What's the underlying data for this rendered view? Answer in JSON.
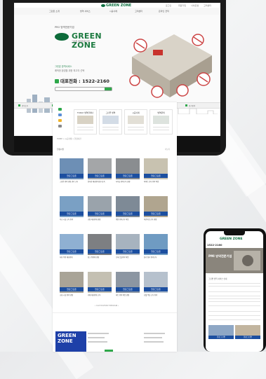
{
  "desktop": {
    "topbar_links": [
      "로그인",
      "회원가입",
      "사이트맵",
      "고객센터"
    ],
    "logo": "GREEN ZONE",
    "nav": [
      "그린존 소개",
      "방역 서비스",
      "시공사례",
      "고객센터",
      "온라인 견적"
    ],
    "hero": {
      "kicker": "PRO 방역전문기업",
      "brand": "GREEN ZONE",
      "brand_sub": "그린존 방역전문기업",
      "line1": "그린존 방역서비스",
      "line2": "쾌적한 환경을 위한 최고의 선택",
      "phone_label": "대표전화 :",
      "phone": "1522-2160",
      "search_label": "견적문의"
    },
    "infobar": [
      "방역소독",
      "해충방제",
      "쥐방제",
      "흰개미방제",
      "소독필증 발급",
      "정기방역"
    ]
  },
  "longpage": {
    "services": [
      {
        "title": "TODAY 방역플래너"
      },
      {
        "title": "그린존 방역"
      },
      {
        "title": "시공사례"
      },
      {
        "title": "방역문의"
      }
    ],
    "path": "HOME > 시공사례 > 현장사진",
    "section_title": "현장사진",
    "more": "더보기",
    "card_label": "현장그린존",
    "card_captions": [
      "그린존 방역 현장 관리 소독",
      "음식점 해충방제 정기소독",
      "사무실 방역소독 현장",
      "아파트 단지 방역 작업",
      "학교 시설 소독 방역",
      "공장 해충방제 현장",
      "병원 방역소독 작업",
      "어린이집 소독 현장",
      "식당 주방 해충방제",
      "창고 쥐방제 현장",
      "오피스텔 방역 작업",
      "상가 정기 방역소독",
      "교회 시설 방역 현장",
      "카페 해충방제 소독",
      "마트 방역 작업 현장",
      "호텔 객실 소독 방역"
    ],
    "pager": "‹ 1 2 3 4 5 6 7 8 9 10 ›",
    "footer_logo": "GREEN ZONE"
  },
  "mobile": {
    "logo": "GREEN ZONE",
    "phone": "1522-2160",
    "hero_title": "PMI 방역전문기업",
    "intro": "그린존 방역 서비스 안내",
    "card_label": "현장그린존"
  }
}
